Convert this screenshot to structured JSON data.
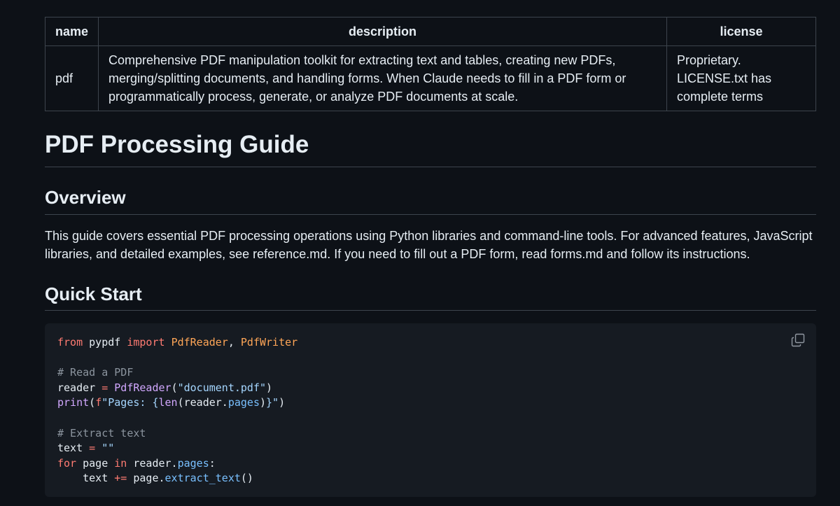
{
  "table": {
    "headers": [
      "name",
      "description",
      "license"
    ],
    "row": {
      "name": "pdf",
      "description": "Comprehensive PDF manipulation toolkit for extracting text and tables, creating new PDFs, merging/splitting documents, and handling forms. When Claude needs to fill in a PDF form or programmatically process, generate, or analyze PDF documents at scale.",
      "license": "Proprietary. LICENSE.txt has complete terms"
    }
  },
  "title": "PDF Processing Guide",
  "overview": {
    "heading": "Overview",
    "text": "This guide covers essential PDF processing operations using Python libraries and command-line tools. For advanced features, JavaScript libraries, and detailed examples, see reference.md. If you need to fill out a PDF form, read forms.md and follow its instructions."
  },
  "quick_start": {
    "heading": "Quick Start"
  },
  "code": {
    "lines": [
      "from pypdf import PdfReader, PdfWriter",
      "",
      "# Read a PDF",
      "reader = PdfReader(\"document.pdf\")",
      "print(f\"Pages: {len(reader.pages)}\")",
      "",
      "# Extract text",
      "text = \"\"",
      "for page in reader.pages:",
      "    text += page.extract_text()"
    ],
    "copy_icon": "copy-icon"
  },
  "colors": {
    "background": "#0d1117",
    "code_background": "#161b22",
    "border": "#3d444d",
    "text": "#e6edf3",
    "keyword": "#ff7b72",
    "class": "#ffa657",
    "function": "#d2a8ff",
    "string": "#a5d6ff",
    "comment": "#8b949e",
    "attribute": "#79c0ff"
  }
}
